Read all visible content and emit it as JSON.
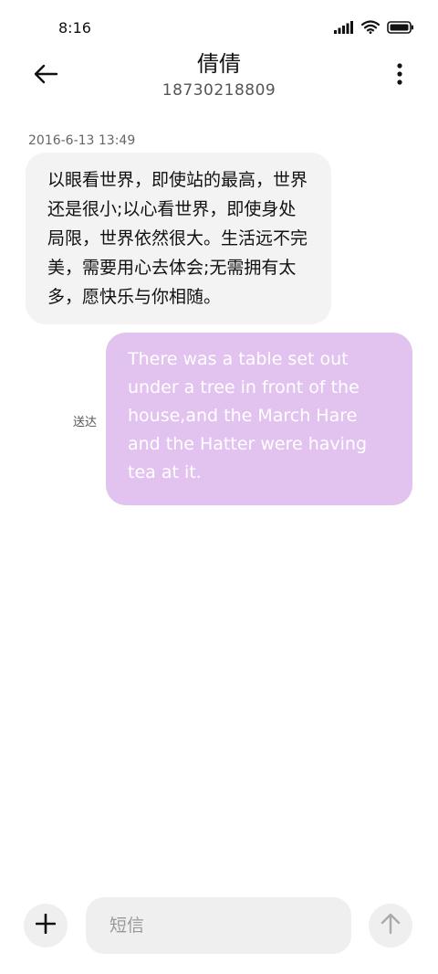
{
  "status_bar": {
    "time": "8:16",
    "icons": [
      "signal-icon",
      "wifi-icon",
      "battery-icon"
    ]
  },
  "header": {
    "back_icon": "arrow-left-icon",
    "contact_name": "倩倩",
    "contact_number": "18730218809",
    "more_icon": "more-vertical-icon"
  },
  "conversation": {
    "timestamp": "2016-6-13 13:49",
    "messages": [
      {
        "direction": "incoming",
        "text": "以眼看世界，即使站的最高，世界还是很小;以心看世界，即使身处局限，世界依然很大。生活远不完美，需要用心去体会;无需拥有太多，愿快乐与你相随。"
      },
      {
        "direction": "outgoing",
        "text": "There was a table set out under a tree in front of the house,and the March Hare and the Hatter were having tea at it.",
        "status": "送达"
      }
    ]
  },
  "composer": {
    "add_icon": "plus-icon",
    "placeholder": "短信",
    "value": "",
    "send_icon": "arrow-up-icon"
  },
  "colors": {
    "incoming_bubble": "#f3f3f3",
    "outgoing_bubble": "#e2c3ef",
    "outgoing_text": "#ffffff",
    "background": "#ffffff"
  }
}
